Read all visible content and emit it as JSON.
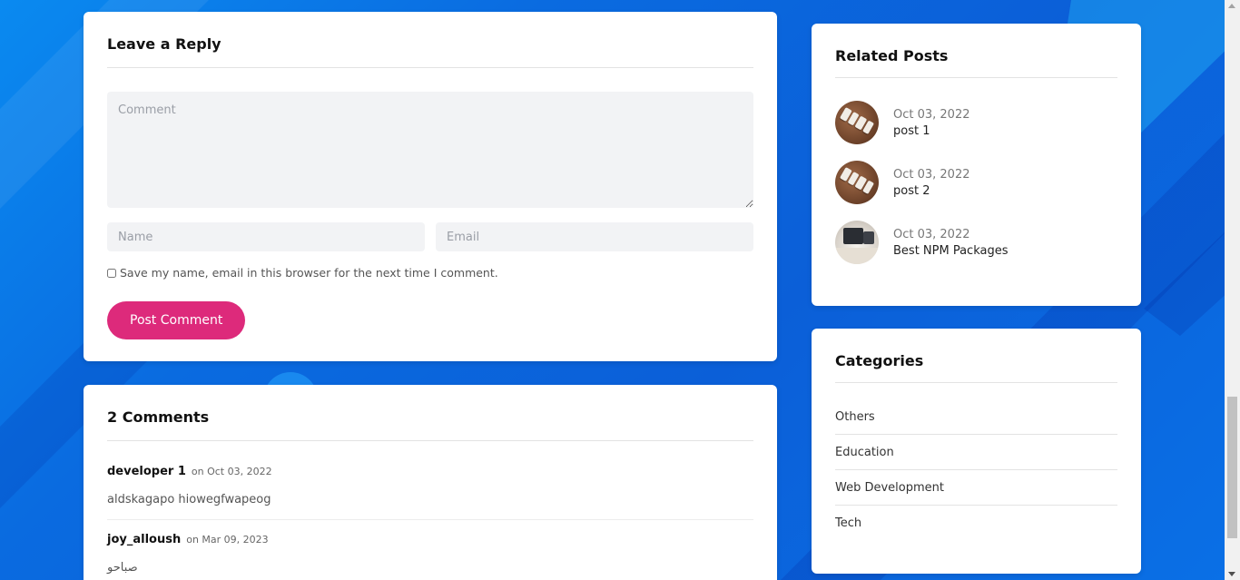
{
  "reply": {
    "title": "Leave a Reply",
    "comment_placeholder": "Comment",
    "name_placeholder": "Name",
    "email_placeholder": "Email",
    "save_label": "Save my name, email in this browser for the next time I comment.",
    "post_button": "Post Comment"
  },
  "comments": {
    "title": "2 Comments",
    "items": [
      {
        "author": "developer 1",
        "date": "on Oct 03, 2022",
        "body": "aldskagapo hiowegfwapeog"
      },
      {
        "author": "joy_alloush",
        "date": "on Mar 09, 2023",
        "body": "صباحو"
      }
    ]
  },
  "related": {
    "title": "Related Posts",
    "items": [
      {
        "date": "Oct 03, 2022",
        "title": "post 1",
        "thumb": "wood-keys-image"
      },
      {
        "date": "Oct 03, 2022",
        "title": "post 2",
        "thumb": "wood-keys-image"
      },
      {
        "date": "Oct 03, 2022",
        "title": "Best NPM Packages",
        "thumb": "desk-monitor-image"
      }
    ]
  },
  "categories": {
    "title": "Categories",
    "items": [
      "Others",
      "Education",
      "Web Development",
      "Tech"
    ]
  },
  "colors": {
    "accent": "#dd2a7b",
    "background": "#0a6be0"
  }
}
